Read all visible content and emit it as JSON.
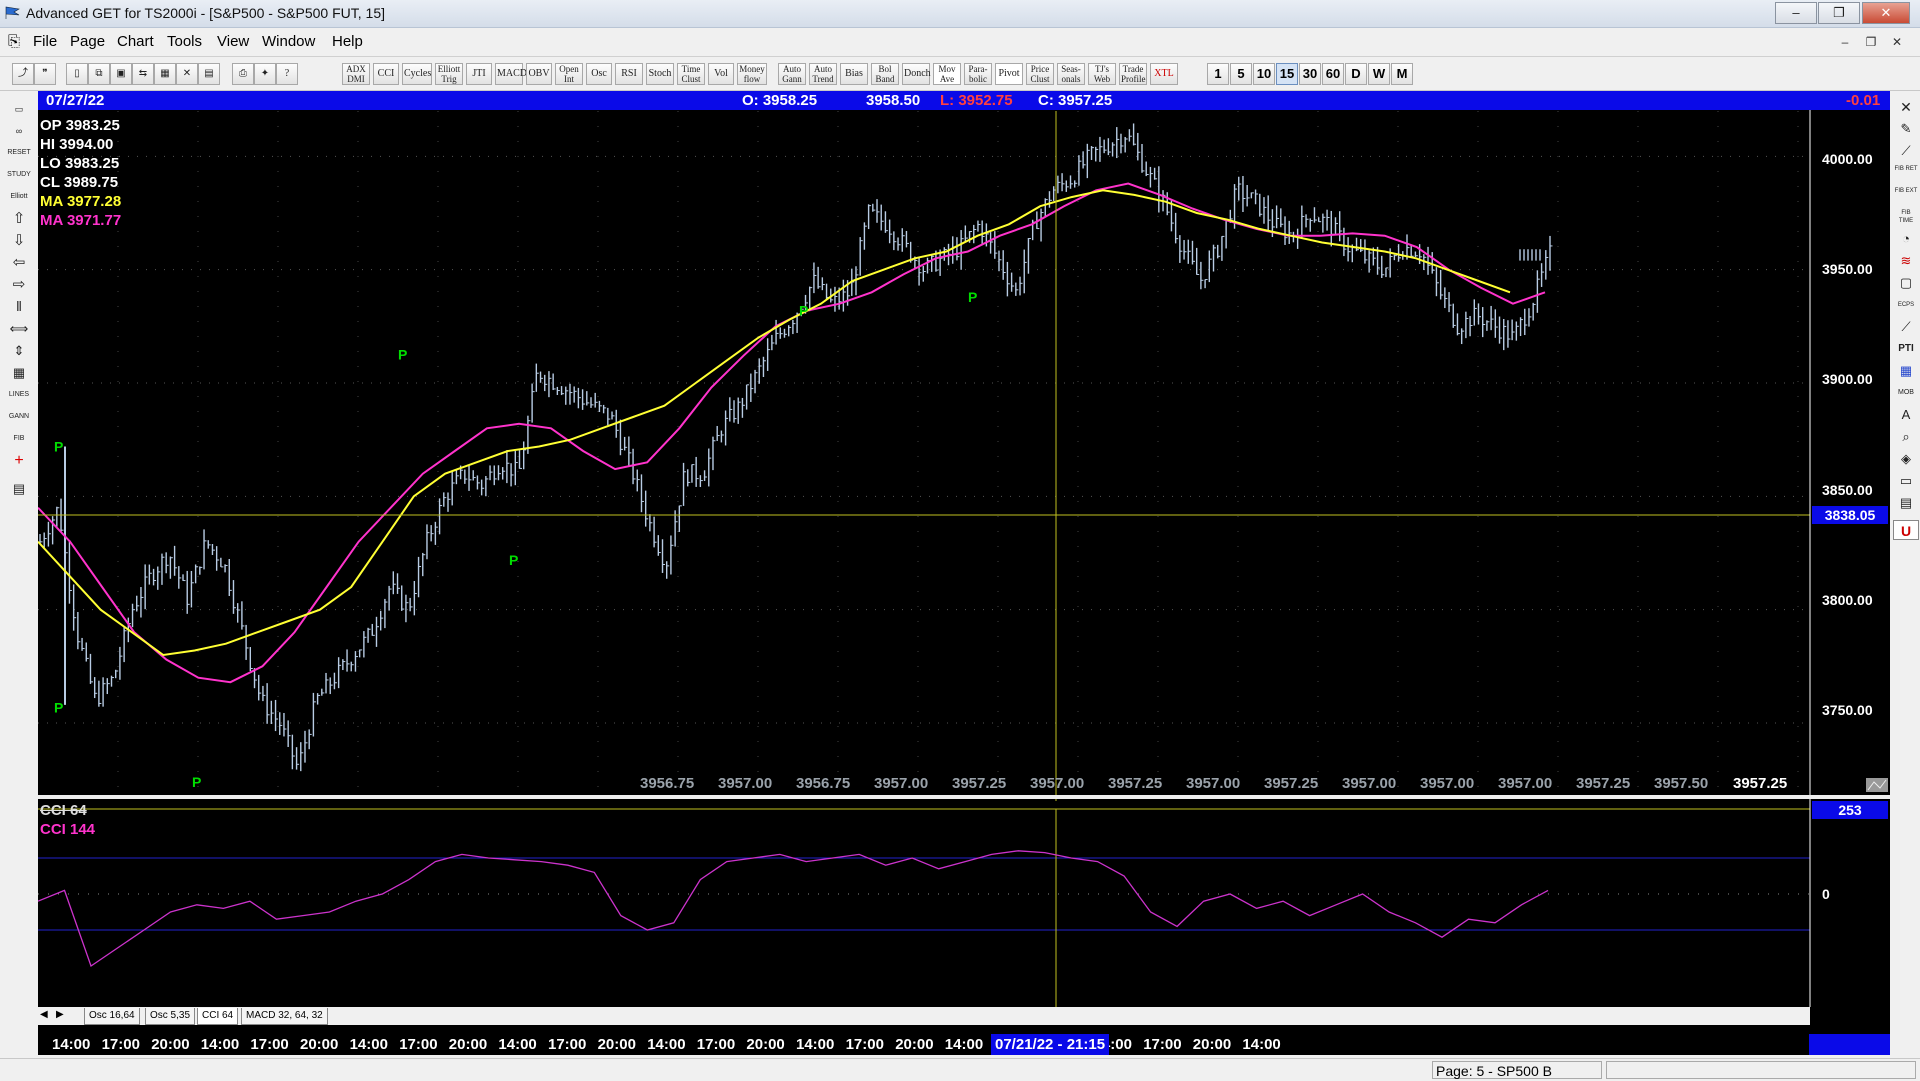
{
  "window": {
    "title": "Advanced GET for TS2000i - [S&P500 - S&P500 FUT, 15]",
    "buttons": {
      "minimize": "–",
      "maximize": "❐",
      "close": "✕"
    }
  },
  "menu": [
    "File",
    "Page",
    "Chart",
    "Tools",
    "View",
    "Window",
    "Help"
  ],
  "mdi_buttons": [
    "–",
    "❐",
    "✕"
  ],
  "toolbar": {
    "study_buttons": [
      {
        "id": "adx",
        "l1": "ADX",
        "l2": "DMI"
      },
      {
        "id": "cci",
        "l1": "CCI",
        "l2": ""
      },
      {
        "id": "cycles",
        "l1": "Cycles",
        "l2": ""
      },
      {
        "id": "elliott-trig",
        "l1": "Elliott",
        "l2": "Trig"
      },
      {
        "id": "jti",
        "l1": "JTI",
        "l2": ""
      },
      {
        "id": "macd",
        "l1": "MACD",
        "l2": ""
      },
      {
        "id": "obv",
        "l1": "OBV",
        "l2": ""
      },
      {
        "id": "open-int",
        "l1": "Open",
        "l2": "Int"
      },
      {
        "id": "osc",
        "l1": "Osc",
        "l2": ""
      },
      {
        "id": "rsi",
        "l1": "RSI",
        "l2": ""
      },
      {
        "id": "stoch",
        "l1": "Stoch",
        "l2": ""
      },
      {
        "id": "time-clust",
        "l1": "Time",
        "l2": "Clust"
      },
      {
        "id": "vol",
        "l1": "Vol",
        "l2": ""
      },
      {
        "id": "money-flow",
        "l1": "Money",
        "l2": "flow"
      },
      {
        "id": "auto-gann",
        "l1": "Auto",
        "l2": "Gann"
      },
      {
        "id": "auto-trend",
        "l1": "Auto",
        "l2": "Trend"
      },
      {
        "id": "bias",
        "l1": "Bias",
        "l2": ""
      },
      {
        "id": "bol-band",
        "l1": "Bol",
        "l2": "Band"
      },
      {
        "id": "donch",
        "l1": "Donch",
        "l2": ""
      },
      {
        "id": "mov-ave",
        "l1": "Mov",
        "l2": "Ave"
      },
      {
        "id": "para-bolic",
        "l1": "Para-",
        "l2": "bolic"
      },
      {
        "id": "pivot",
        "l1": "Pivot",
        "l2": ""
      },
      {
        "id": "price-clust",
        "l1": "Price",
        "l2": "Clust"
      },
      {
        "id": "seasonals",
        "l1": "Seas-",
        "l2": "onals"
      },
      {
        "id": "tjs-web",
        "l1": "TJ's",
        "l2": "Web"
      },
      {
        "id": "trade-profile",
        "l1": "Trade",
        "l2": "Profile"
      },
      {
        "id": "xtl",
        "l1": "XTL",
        "l2": ""
      }
    ],
    "timeframes": [
      "1",
      "5",
      "10",
      "15",
      "30",
      "60",
      "D",
      "W",
      "M"
    ],
    "selected_timeframe": "15"
  },
  "sidebar_left": [
    "RESET",
    "STUDY",
    "Elliott",
    "LINES",
    "GANN",
    "FIB"
  ],
  "sidebar_right": [
    "FIB RET",
    "FIB EXT",
    "FIB TIME",
    "ECPS",
    "PTI",
    "MOB",
    "A",
    "U"
  ],
  "chart_header": {
    "date": "07/27/22",
    "open": "O: 3958.25",
    "high": "3958.50",
    "low": "L: 3952.75",
    "close": "C: 3957.25",
    "change": "-0.01"
  },
  "stats": {
    "op": "OP  3983.25",
    "hi": "HI   3994.00",
    "lo": "LO  3983.25",
    "cl": "CL  3989.75",
    "ma1": "MA  3977.28",
    "ma2": "MA  3971.77"
  },
  "price_axis": [
    "4000.00",
    "3950.00",
    "3900.00",
    "3850.00",
    "3800.00",
    "3750.00"
  ],
  "crosshair_price": "3838.05",
  "bottom_values": [
    "3956.75",
    "3957.00",
    "3956.75",
    "3957.00",
    "3957.25",
    "3957.00",
    "3957.25",
    "3957.00",
    "3957.25",
    "3957.00",
    "3957.00",
    "3957.00",
    "3957.25",
    "3957.50",
    "3957.25"
  ],
  "cci_panel": {
    "label1": "CCI 64",
    "label2": "CCI  144",
    "top_value": "253",
    "zero_label": "0"
  },
  "pivot_marker": "P",
  "tabs": [
    "Osc 16,64",
    "Osc 5,35",
    "CCI 64",
    "MACD 32, 64, 32"
  ],
  "time_axis": [
    "14:00",
    "17:00",
    "20:00",
    "14:00",
    "17:00",
    "20:00",
    "14:00",
    "17:00",
    "20:00",
    "14:00",
    "17:00",
    "20:00",
    "14:00",
    "17:00",
    "20:00",
    "14:00",
    "17:00",
    "20:00",
    "14:00",
    "17:00",
    "20:00",
    "14:00",
    "17:00",
    "20:00",
    "14:00"
  ],
  "crosshair_time": "07/21/22 - 21:15",
  "status": "Page: 5 - SP500 B",
  "colors": {
    "chart_bg": "#000000",
    "bars": "#b8cce4",
    "ma_fast": "#ffff33",
    "ma_slow": "#ff33cc",
    "pivot": "#00dd00",
    "crosshair": "#bfbf20",
    "header": "#0a0ae8",
    "cci_line": "#cc33cc",
    "cci_bands": "#2222cc"
  },
  "chart_data": {
    "type": "candlestick",
    "ylim": [
      3720,
      4020
    ],
    "yticks": [
      3750,
      3800,
      3850,
      3900,
      3950,
      4000
    ],
    "close_path": [
      3830,
      3845,
      3790,
      3760,
      3770,
      3800,
      3815,
      3825,
      3805,
      3830,
      3820,
      3790,
      3760,
      3750,
      3730,
      3760,
      3770,
      3780,
      3790,
      3810,
      3800,
      3830,
      3850,
      3860,
      3855,
      3865,
      3860,
      3905,
      3900,
      3895,
      3890,
      3885,
      3865,
      3840,
      3820,
      3860,
      3860,
      3880,
      3890,
      3905,
      3920,
      3930,
      3945,
      3935,
      3940,
      3975,
      3970,
      3960,
      3950,
      3955,
      3960,
      3970,
      3955,
      3940,
      3970,
      3985,
      3990,
      4000,
      4005,
      4010,
      3995,
      3980,
      3960,
      3945,
      3960,
      3985,
      3980,
      3970,
      3965,
      3975,
      3970,
      3960,
      3955,
      3950,
      3960,
      3958,
      3940,
      3925,
      3930,
      3925,
      3920,
      3935,
      3957
    ],
    "ma_fast": [
      3830,
      3815,
      3800,
      3790,
      3780,
      3782,
      3785,
      3790,
      3795,
      3800,
      3810,
      3830,
      3850,
      3860,
      3865,
      3870,
      3872,
      3875,
      3880,
      3885,
      3890,
      3900,
      3910,
      3920,
      3928,
      3935,
      3945,
      3950,
      3955,
      3958,
      3965,
      3970,
      3978,
      3982,
      3985,
      3983,
      3980,
      3975,
      3972,
      3968,
      3965,
      3962,
      3960,
      3958,
      3955,
      3950,
      3945,
      3940
    ],
    "ma_slow": [
      3845,
      3830,
      3810,
      3790,
      3778,
      3770,
      3768,
      3775,
      3790,
      3810,
      3830,
      3845,
      3860,
      3870,
      3880,
      3882,
      3880,
      3870,
      3862,
      3865,
      3880,
      3898,
      3912,
      3925,
      3932,
      3935,
      3940,
      3948,
      3955,
      3958,
      3965,
      3970,
      3978,
      3985,
      3988,
      3983,
      3977,
      3972,
      3968,
      3965,
      3965,
      3966,
      3965,
      3960,
      3950,
      3942,
      3935,
      3940
    ],
    "pivots": [
      {
        "price": 3760,
        "label": "P"
      },
      {
        "price": 3875,
        "label": "P"
      },
      {
        "price": 3727,
        "label": "P"
      },
      {
        "price": 3905,
        "label": "P"
      },
      {
        "price": 3825,
        "label": "P"
      },
      {
        "price": 3935,
        "label": "P"
      },
      {
        "price": 3941,
        "label": "P"
      }
    ],
    "cci": [
      -20,
      10,
      -200,
      -150,
      -100,
      -50,
      -30,
      -40,
      -20,
      -70,
      -60,
      -50,
      -20,
      0,
      40,
      90,
      110,
      100,
      95,
      90,
      80,
      60,
      -60,
      -100,
      -80,
      40,
      90,
      100,
      110,
      90,
      100,
      110,
      80,
      100,
      70,
      90,
      110,
      120,
      115,
      100,
      90,
      50,
      -50,
      -90,
      -20,
      0,
      -40,
      -20,
      -60,
      -30,
      0,
      -50,
      -80,
      -120,
      -70,
      -80,
      -30,
      10
    ]
  }
}
